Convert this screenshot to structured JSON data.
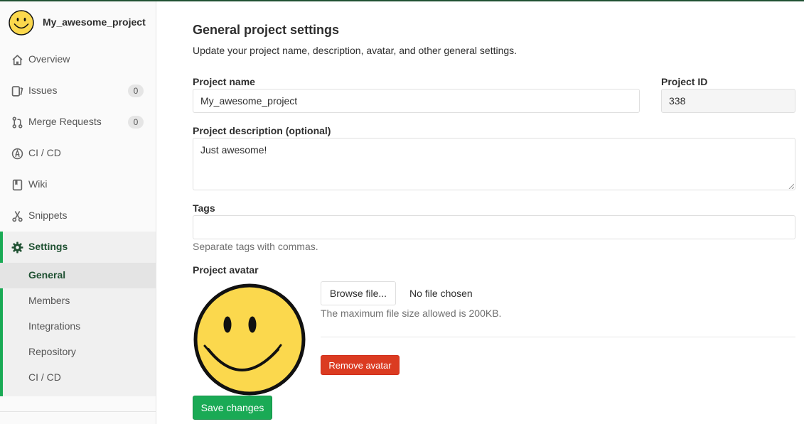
{
  "project": {
    "name": "My_awesome_project",
    "avatar_icon": "smiley-face-icon"
  },
  "sidebar": {
    "items": [
      {
        "label": "Overview",
        "icon": "home-icon"
      },
      {
        "label": "Issues",
        "icon": "issues-icon",
        "badge": "0"
      },
      {
        "label": "Merge Requests",
        "icon": "merge-request-icon",
        "badge": "0"
      },
      {
        "label": "CI / CD",
        "icon": "rocket-icon"
      },
      {
        "label": "Wiki",
        "icon": "book-icon"
      },
      {
        "label": "Snippets",
        "icon": "scissors-icon"
      }
    ],
    "settings": {
      "label": "Settings",
      "icon": "gear-icon",
      "sub_items": [
        {
          "label": "General",
          "active": true
        },
        {
          "label": "Members"
        },
        {
          "label": "Integrations"
        },
        {
          "label": "Repository"
        },
        {
          "label": "CI / CD"
        }
      ]
    }
  },
  "main": {
    "title": "General project settings",
    "subtitle": "Update your project name, description, avatar, and other general settings.",
    "project_name_label": "Project name",
    "project_name_value": "My_awesome_project",
    "project_id_label": "Project ID",
    "project_id_value": "338",
    "description_label": "Project description (optional)",
    "description_value": "Just awesome!",
    "tags_label": "Tags",
    "tags_value": "",
    "tags_help": "Separate tags with commas.",
    "avatar_label": "Project avatar",
    "browse_label": "Browse file...",
    "no_file": "No file chosen",
    "max_size_help": "The maximum file size allowed is 200KB.",
    "remove_avatar_label": "Remove avatar",
    "save_label": "Save changes"
  },
  "colors": {
    "accent": "#1aaa55",
    "active_text": "#1f5132",
    "danger": "#db3b21"
  }
}
